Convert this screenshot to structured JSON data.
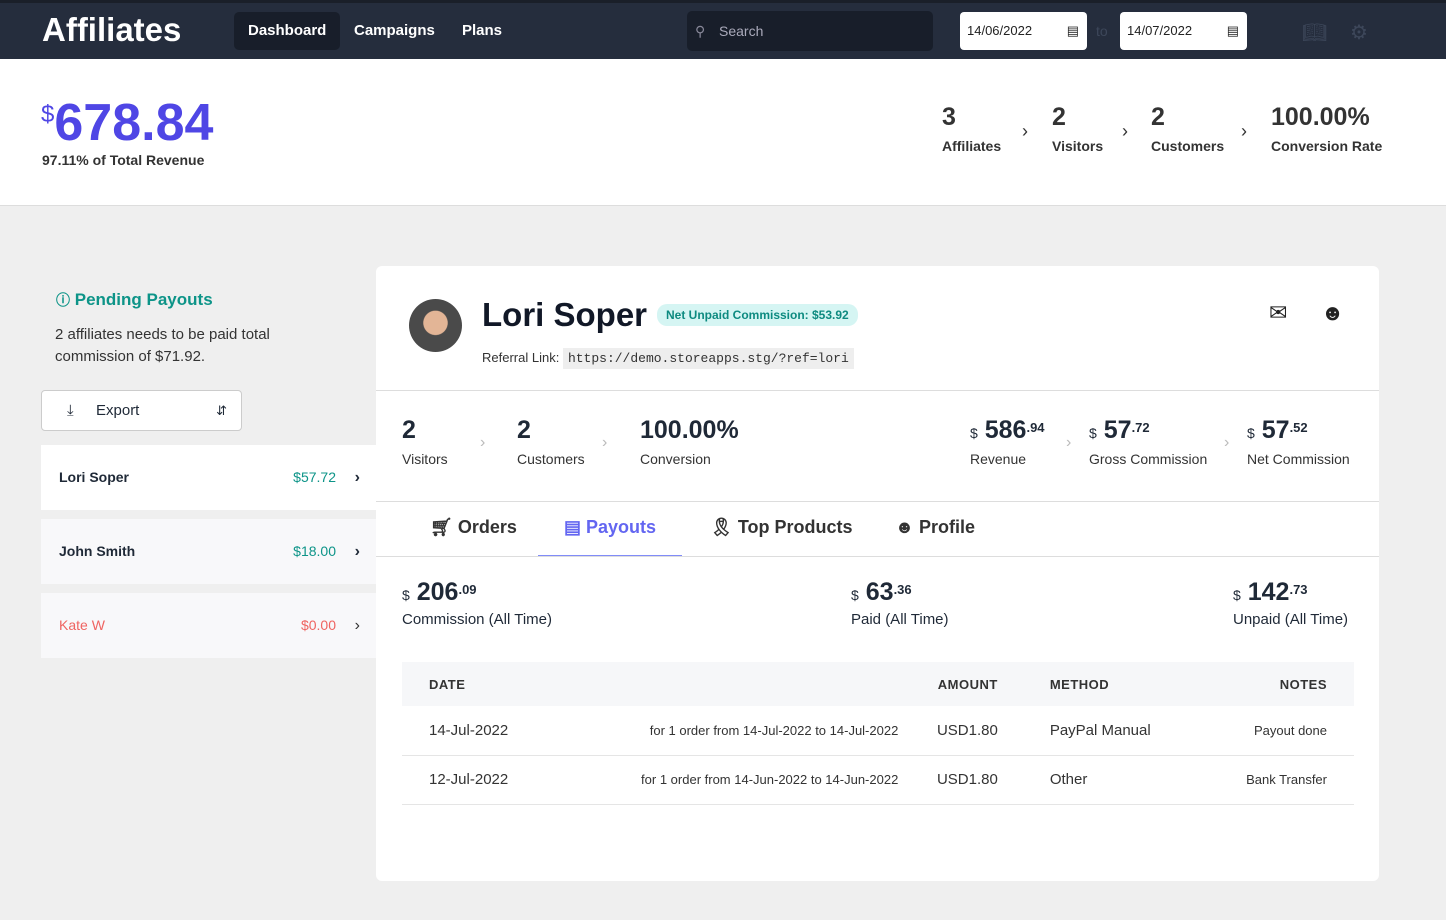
{
  "nav": {
    "brand": "Affiliates",
    "items": [
      "Dashboard",
      "Campaigns",
      "Plans"
    ],
    "search_placeholder": "Search",
    "date_from": "14/06/2022",
    "date_to": "14/07/2022",
    "to_label": "to"
  },
  "summary": {
    "currency": "$",
    "total": "678.84",
    "subtitle": "97.11% of Total Revenue",
    "kpis": [
      {
        "value": "3",
        "label": "Affiliates"
      },
      {
        "value": "2",
        "label": "Visitors"
      },
      {
        "value": "2",
        "label": "Customers"
      },
      {
        "value": "100.00%",
        "label": "Conversion Rate"
      }
    ]
  },
  "pending": {
    "title": "Pending Payouts",
    "text": "2 affiliates needs to be paid total commission of $71.92.",
    "export": "Export"
  },
  "affiliates": [
    {
      "name": "Lori Soper",
      "amount": "$57.72"
    },
    {
      "name": "John Smith",
      "amount": "$18.00"
    },
    {
      "name": "Kate W",
      "amount": "$0.00"
    }
  ],
  "colors": {
    "accent": "#4f46e5",
    "teal": "#0d9488",
    "danger": "#ef6461",
    "nav": "#252d3d"
  },
  "detail": {
    "name": "Lori Soper",
    "badge": "Net Unpaid Commission: $53.92",
    "ref_label": "Referral Link:",
    "ref_link": "https://demo.storeapps.stg/?ref=lori",
    "stats": [
      {
        "value": "2",
        "label": "Visitors"
      },
      {
        "value": "2",
        "label": "Customers"
      },
      {
        "value": "100.00%",
        "label": "Conversion"
      }
    ],
    "money": [
      {
        "cur": "$",
        "int": "586",
        "dec": ".94",
        "label": "Revenue"
      },
      {
        "cur": "$",
        "int": "57",
        "dec": ".72",
        "label": "Gross Commission"
      },
      {
        "cur": "$",
        "int": "57",
        "dec": ".52",
        "label": "Net Commission"
      }
    ],
    "tabs": [
      "Orders",
      "Payouts",
      "Top Products",
      "Profile"
    ],
    "totals": [
      {
        "cur": "$",
        "int": "206",
        "dec": ".09",
        "label": "Commission (All Time)"
      },
      {
        "cur": "$",
        "int": "63",
        "dec": ".36",
        "label": "Paid (All Time)"
      },
      {
        "cur": "$",
        "int": "142",
        "dec": ".73",
        "label": "Unpaid (All Time)"
      }
    ],
    "table": {
      "headers": [
        "DATE",
        "",
        "AMOUNT",
        "METHOD",
        "NOTES"
      ],
      "rows": [
        [
          "14-Jul-2022",
          "for 1 order from 14-Jul-2022 to 14-Jul-2022",
          "USD1.80",
          "PayPal Manual",
          "Payout done"
        ],
        [
          "12-Jul-2022",
          "for 1 order from 14-Jun-2022 to 14-Jun-2022",
          "USD1.80",
          "Other",
          "Bank Transfer"
        ]
      ]
    }
  }
}
